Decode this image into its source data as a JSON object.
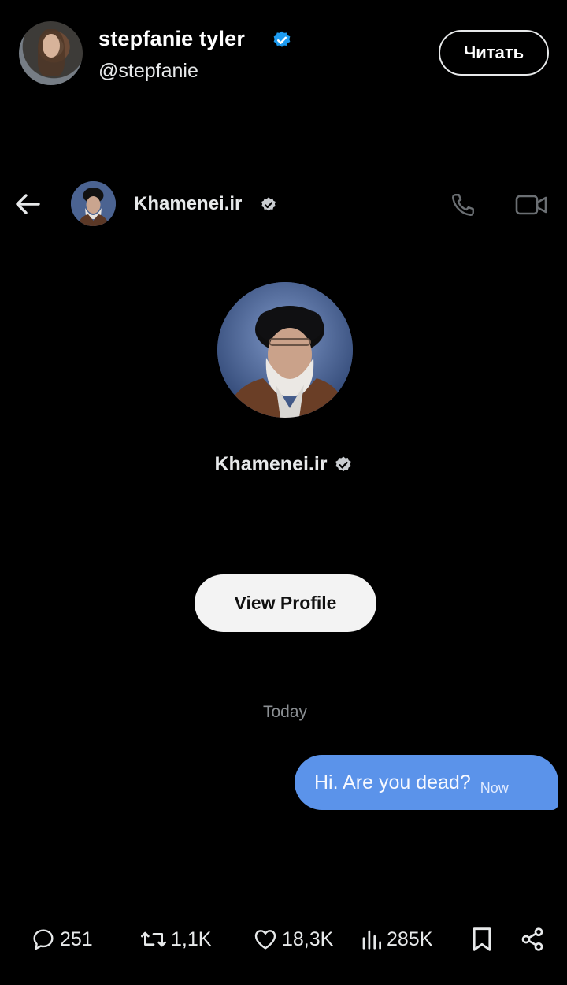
{
  "tweet": {
    "author_name": "stepfanie tyler",
    "author_handle": "@stepfanie",
    "follow_label": "Читать",
    "verified_color": "#1d9bf0"
  },
  "dm": {
    "contact_name": "Khamenei.ir",
    "view_profile_label": "View Profile",
    "date_separator": "Today",
    "message": {
      "text": "Hi. Are you dead?",
      "time": "Now"
    },
    "bubble_color": "#5b93ea",
    "icons": [
      "back-arrow-icon",
      "phone-icon",
      "video-icon",
      "verified-gray-icon"
    ]
  },
  "actions": {
    "replies": "251",
    "reposts": "1,1K",
    "likes": "18,3K",
    "views": "285K",
    "icons": [
      "reply-icon",
      "repost-icon",
      "like-icon",
      "views-icon",
      "bookmark-icon",
      "share-icon"
    ]
  }
}
